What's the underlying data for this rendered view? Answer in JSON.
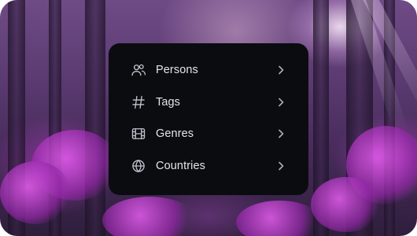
{
  "background": {
    "description_icon": "forest-background"
  },
  "menu": {
    "items": [
      {
        "label": "Persons",
        "icon": "users-icon"
      },
      {
        "label": "Tags",
        "icon": "hash-icon"
      },
      {
        "label": "Genres",
        "icon": "film-icon"
      },
      {
        "label": "Countries",
        "icon": "globe-icon"
      }
    ],
    "chevron_icon": "chevron-right-icon"
  },
  "colors": {
    "menu_bg": "#0b0c10",
    "text": "#e3e5ea",
    "icon": "#bfc3cc"
  }
}
